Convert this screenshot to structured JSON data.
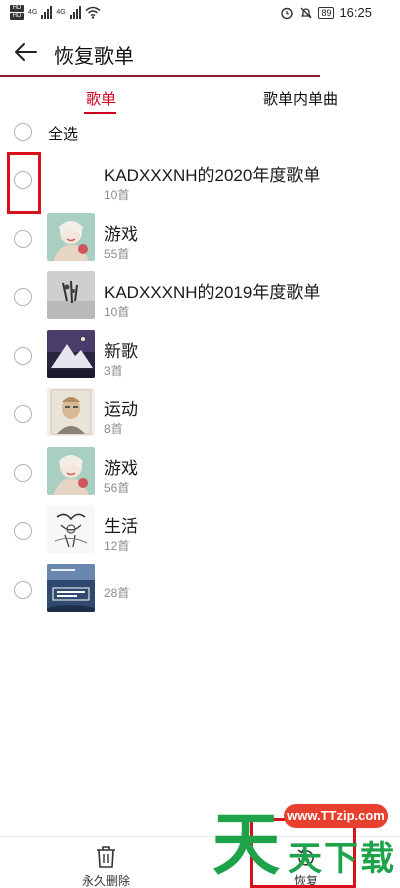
{
  "status_bar": {
    "sim1_tag": "HD",
    "sim2_tag": "HD",
    "net1": "4G",
    "net2": "4G",
    "battery": "89",
    "time": "16:25"
  },
  "header": {
    "title": "恢复歌单",
    "back_icon": "arrow-left-icon"
  },
  "tabs": [
    {
      "label": "歌单",
      "active": true
    },
    {
      "label": "歌单内单曲",
      "active": false
    }
  ],
  "select_all_label": "全选",
  "playlists": [
    {
      "title": "KADXXXNH的2020年度歌单",
      "count": "10首",
      "cover": "empty"
    },
    {
      "title": "游戏",
      "count": "55首",
      "cover": "illustration-girl"
    },
    {
      "title": "KADXXXNH的2019年度歌单",
      "count": "10首",
      "cover": "gray-figures"
    },
    {
      "title": "新歌",
      "count": "3首",
      "cover": "mountain-night"
    },
    {
      "title": "运动",
      "count": "8首",
      "cover": "portrait"
    },
    {
      "title": "游戏",
      "count": "56首",
      "cover": "illustration-girl"
    },
    {
      "title": "生活",
      "count": "12首",
      "cover": "ink-sketch"
    },
    {
      "title": "",
      "count": "28首",
      "cover": "beats-album"
    }
  ],
  "bottom_bar": {
    "delete_label": "永久删除",
    "restore_label": "恢复"
  },
  "watermark": {
    "url": "www.TTzip.com",
    "big_char": "天",
    "small_chars": "天下载"
  },
  "colors": {
    "accent": "#d0021b",
    "header_line": "#8b1d2a",
    "highlight": "#d6111c",
    "watermark_green": "#1fa34a",
    "watermark_red": "#e8402e"
  }
}
